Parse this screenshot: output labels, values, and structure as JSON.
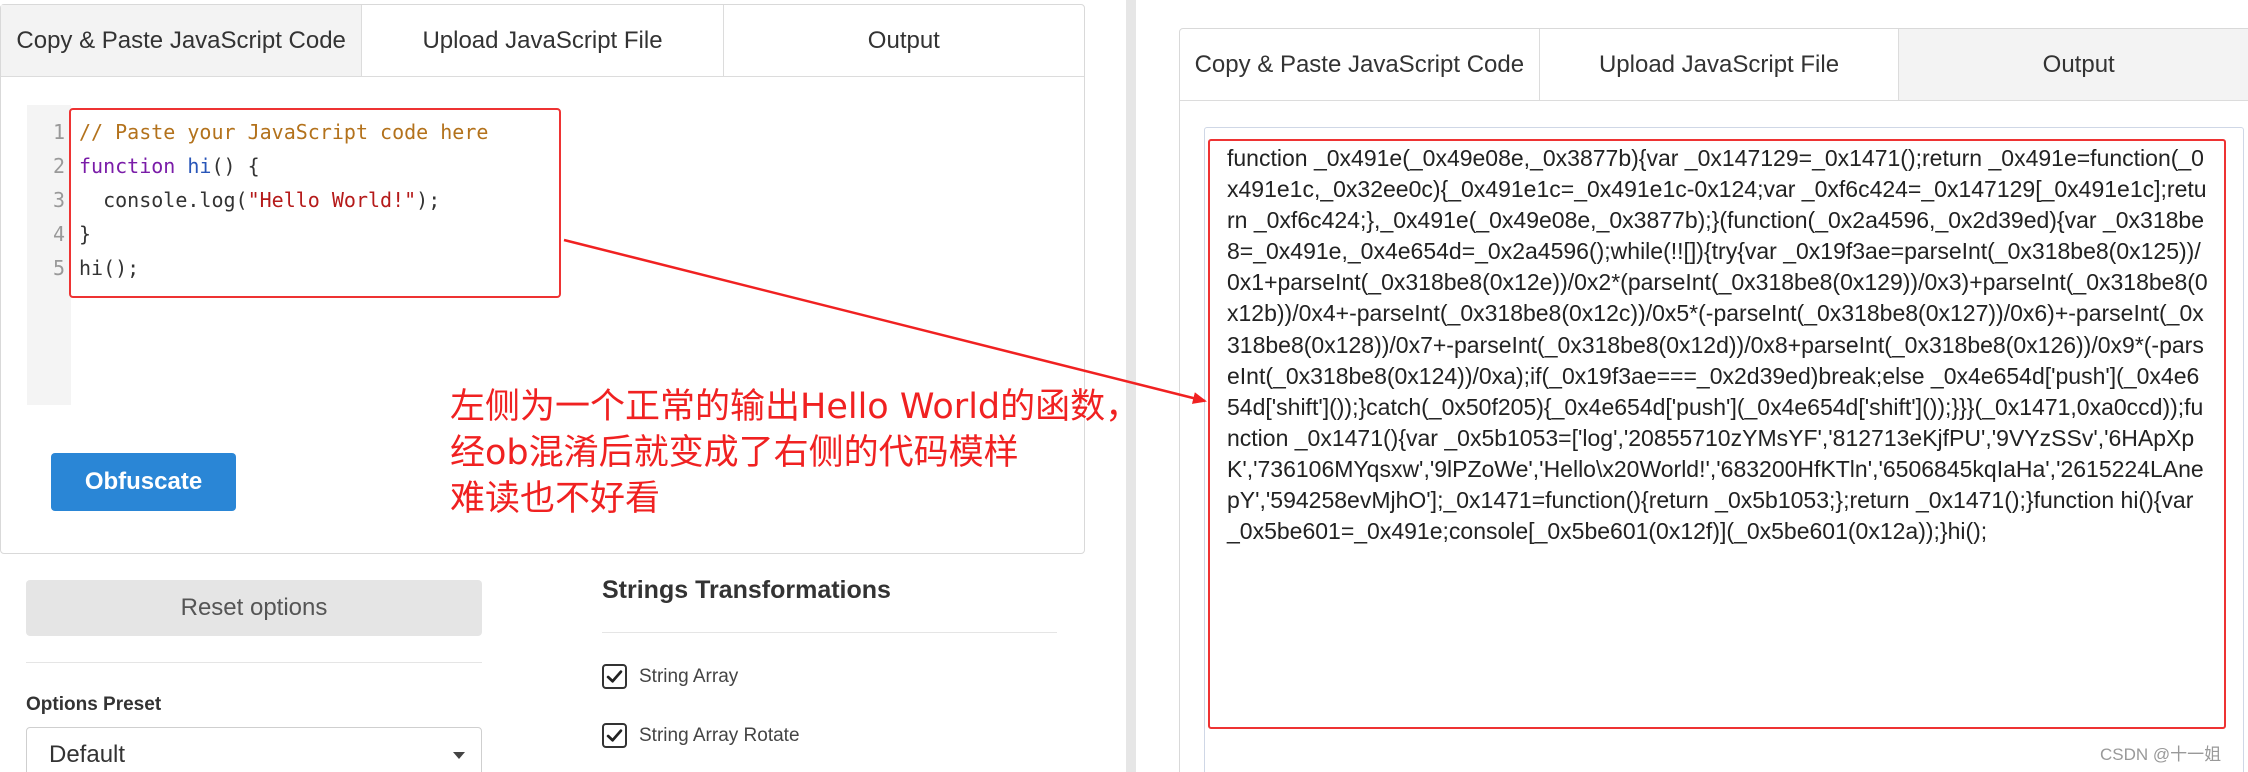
{
  "left_panel": {
    "tabs": [
      "Copy & Paste JavaScript Code",
      "Upload JavaScript File",
      "Output"
    ],
    "line_numbers": [
      "1",
      "2",
      "3",
      "4",
      "5"
    ],
    "code": {
      "line1": "// Paste your JavaScript code here",
      "line2_kw": "function",
      "line2_fn": "hi",
      "line2_rest": "() {",
      "line3_pre": "  console.log(",
      "line3_str": "\"Hello World!\"",
      "line3_post": ");",
      "line4": "}",
      "line5": "hi();"
    },
    "obfuscate_label": "Obfuscate"
  },
  "annotation": {
    "line1": "左侧为一个正常的输出Hello World的函数，",
    "line2": "经ob混淆后就变成了右侧的代码模样",
    "line3": "难读也不好看"
  },
  "options": {
    "reset_label": "Reset options",
    "preset_label": "Options Preset",
    "preset_value": "Default",
    "strings_title": "Strings Transformations",
    "checks": [
      {
        "label": "String Array",
        "checked": true
      },
      {
        "label": "String Array Rotate",
        "checked": true
      }
    ]
  },
  "right_panel": {
    "tabs": [
      "Copy & Paste JavaScript Code",
      "Upload JavaScript File",
      "Output"
    ],
    "output": "function _0x491e(_0x49e08e,_0x3877b){var _0x147129=_0x1471();return _0x491e=function(_0x491e1c,_0x32ee0c){_0x491e1c=_0x491e1c-0x124;var _0xf6c424=_0x147129[_0x491e1c];return _0xf6c424;},_0x491e(_0x49e08e,_0x3877b);}(function(_0x2a4596,_0x2d39ed){var _0x318be8=_0x491e,_0x4e654d=_0x2a4596();while(!![]){try{var _0x19f3ae=parseInt(_0x318be8(0x125))/0x1+parseInt(_0x318be8(0x12e))/0x2*(parseInt(_0x318be8(0x129))/0x3)+parseInt(_0x318be8(0x12b))/0x4+-parseInt(_0x318be8(0x12c))/0x5*(-parseInt(_0x318be8(0x127))/0x6)+-parseInt(_0x318be8(0x128))/0x7+-parseInt(_0x318be8(0x12d))/0x8+parseInt(_0x318be8(0x126))/0x9*(-parseInt(_0x318be8(0x124))/0xa);if(_0x19f3ae===_0x2d39ed)break;else _0x4e654d['push'](_0x4e654d['shift']());}catch(_0x50f205){_0x4e654d['push'](_0x4e654d['shift']());}}}(_0x1471,0xa0ccd));function _0x1471(){var _0x5b1053=['log','20855710zYMsYF','812713eKjfPU','9VYzSSv','6HApXpK','736106MYqsxw','9lPZoWe','Hello\\x20World!','683200HfKTln','6506845kqIaHa','2615224LAnepY','594258evMjhO'];_0x1471=function(){return _0x5b1053;};return _0x1471();}function hi(){var _0x5be601=_0x491e;console[_0x5be601(0x12f)](_0x5be601(0x12a));}hi();"
  },
  "watermark": "CSDN @十一姐",
  "colors": {
    "accent_blue": "#2a86d6",
    "annotation_red": "#f02121",
    "highlight_border": "#e33"
  }
}
